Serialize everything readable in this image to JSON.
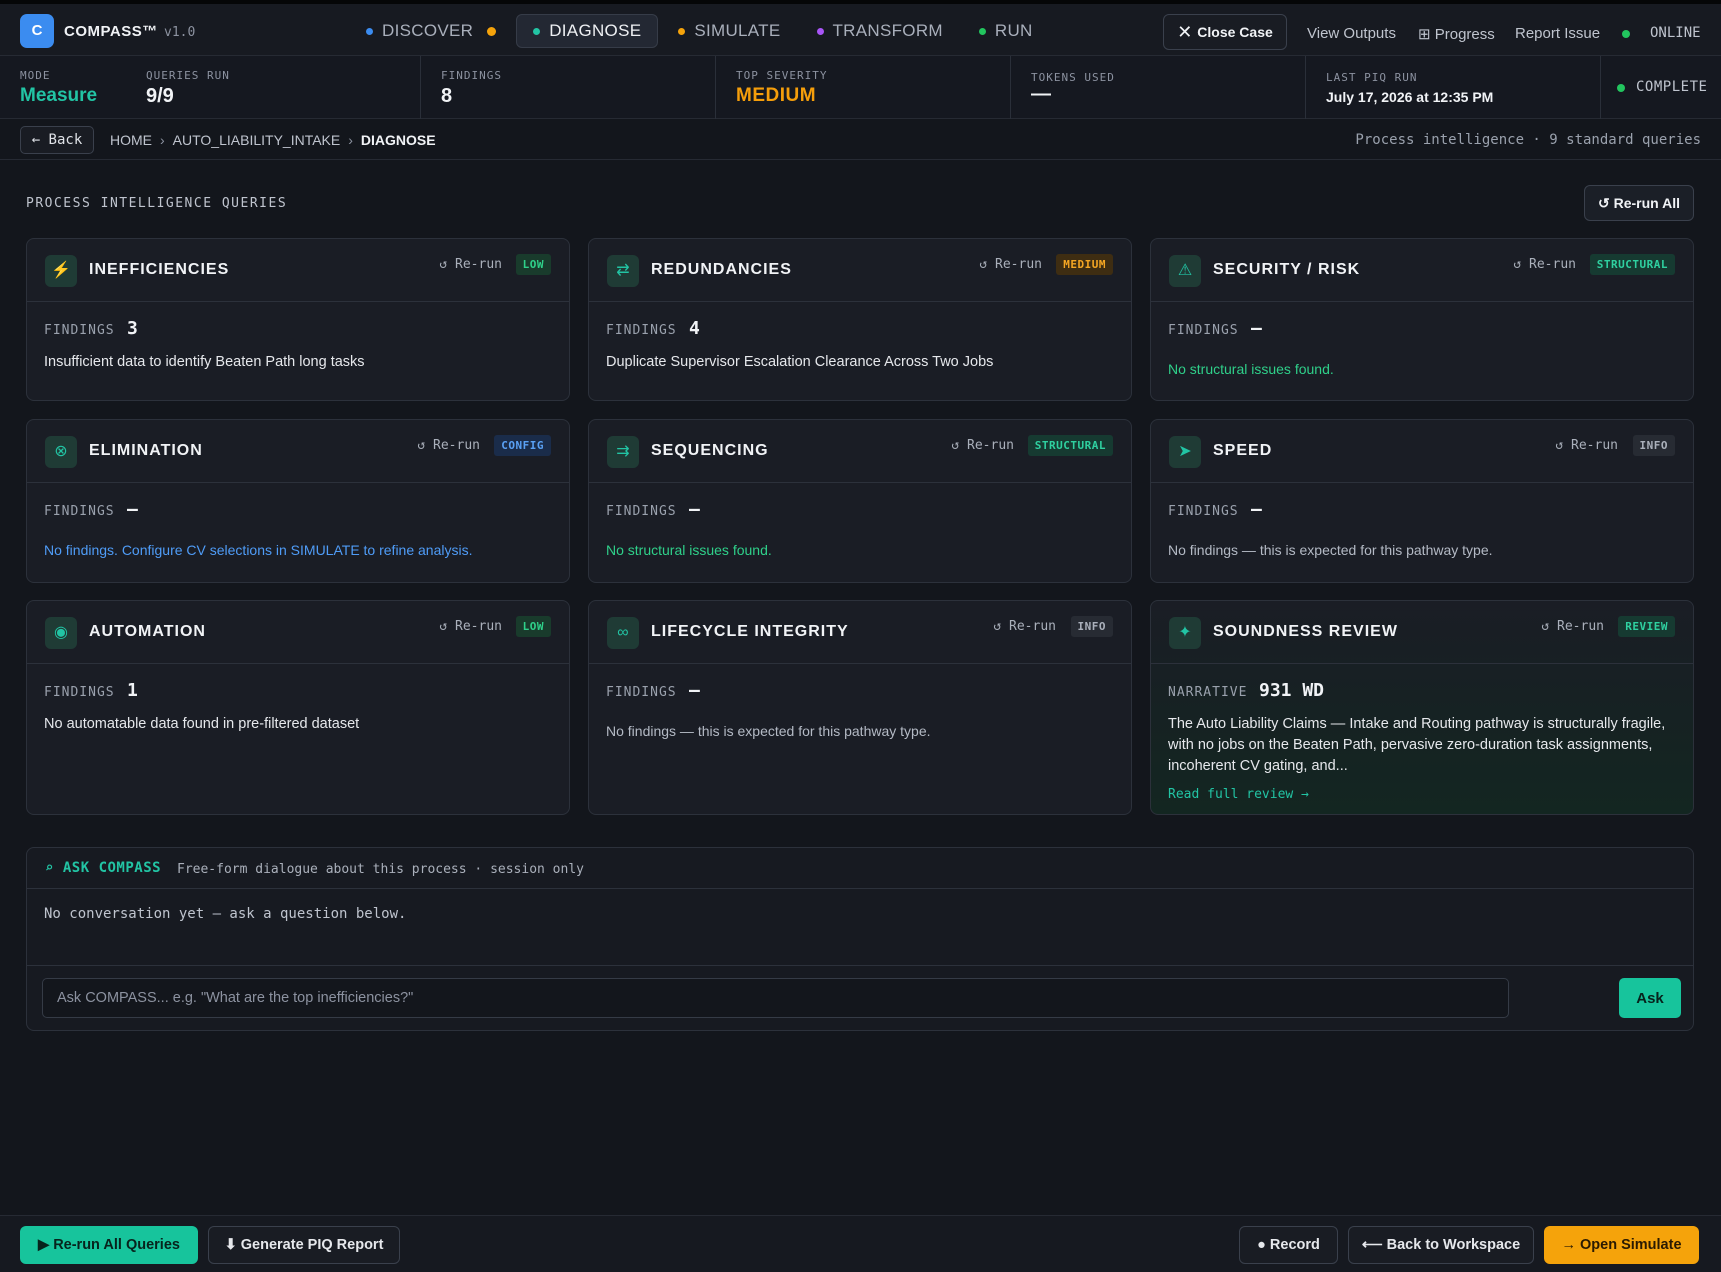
{
  "app": {
    "logo_letter": "C",
    "name": "COMPASS™",
    "version": "v1.0"
  },
  "nav": {
    "tabs": [
      {
        "label": "DISCOVER",
        "dot_color": "#3b8cf0",
        "tail_dot_color": "#f5a30b"
      },
      {
        "label": "DIAGNOSE",
        "dot_color": "#22c4a4",
        "active": true
      },
      {
        "label": "SIMULATE",
        "dot_color": "#f5a30b"
      },
      {
        "label": "TRANSFORM",
        "dot_color": "#a855f7"
      },
      {
        "label": "RUN",
        "dot_color": "#22c55e"
      }
    ],
    "close_case": "Close Case",
    "view_outputs": "View Outputs",
    "progress_icon": "⊞",
    "progress": "Progress",
    "report_issue": "Report Issue",
    "status": "ONLINE"
  },
  "stats": {
    "mode_label": "MODE",
    "mode_value": "Measure",
    "queries_label": "QUERIES RUN",
    "queries_value": "9/9",
    "findings_label": "FINDINGS",
    "findings_value": "8",
    "severity_label": "TOP SEVERITY",
    "severity_value": "MEDIUM",
    "tokens_label": "TOKENS USED",
    "tokens_value": "—",
    "last_run_label": "LAST PIQ RUN",
    "last_run_value": "July 17, 2026 at 12:35 PM",
    "status": "COMPLETE"
  },
  "breadcrumb": {
    "back": "← Back",
    "items": [
      "HOME",
      "AUTO_LIABILITY_INTAKE",
      "DIAGNOSE"
    ],
    "sep": "›",
    "right": "Process intelligence · 9 standard queries"
  },
  "section": {
    "title": "PROCESS INTELLIGENCE QUERIES",
    "rerun_all": "↺ Re-run All"
  },
  "rerun_label": "↺ Re-run",
  "cards": [
    {
      "icon": "⚡",
      "icon_name": "lightning-icon",
      "icon_color": "#f59e0b",
      "title": "INEFFICIENCIES",
      "badge": "LOW",
      "badge_type": "low",
      "findings_label": "FINDINGS",
      "findings": "3",
      "desc": "Insufficient data to identify Beaten Path long tasks",
      "desc_style": "normal"
    },
    {
      "icon": "⇄",
      "icon_name": "swap-arrows-icon",
      "icon_color": "#22c4a4",
      "title": "REDUNDANCIES",
      "badge": "MEDIUM",
      "badge_type": "medium",
      "findings_label": "FINDINGS",
      "findings": "4",
      "desc": "Duplicate Supervisor Escalation Clearance Across Two Jobs",
      "desc_style": "normal"
    },
    {
      "icon": "⚠",
      "icon_name": "warning-triangle-icon",
      "icon_color": "#22c4a4",
      "title": "SECURITY / RISK",
      "badge": "STRUCTURAL",
      "badge_type": "structural",
      "findings_label": "FINDINGS",
      "findings": "—",
      "desc": "No structural issues found.",
      "desc_style": "green"
    },
    {
      "icon": "⊗",
      "icon_name": "circle-x-icon",
      "icon_color": "#22c4a4",
      "title": "ELIMINATION",
      "badge": "CONFIG",
      "badge_type": "config",
      "findings_label": "FINDINGS",
      "findings": "—",
      "desc": "No findings. Configure CV selections in SIMULATE to refine analysis.",
      "desc_style": "blue"
    },
    {
      "icon": "⇉",
      "icon_name": "sequence-arrows-icon",
      "icon_color": "#22c4a4",
      "title": "SEQUENCING",
      "badge": "STRUCTURAL",
      "badge_type": "structural",
      "findings_label": "FINDINGS",
      "findings": "—",
      "desc": "No structural issues found.",
      "desc_style": "green"
    },
    {
      "icon": "➤",
      "icon_name": "send-arrow-icon",
      "icon_color": "#22c4a4",
      "title": "SPEED",
      "badge": "INFO",
      "badge_type": "info",
      "findings_label": "FINDINGS",
      "findings": "—",
      "desc": "No findings — this is expected for this pathway type.",
      "desc_style": "muted"
    },
    {
      "icon": "◉",
      "icon_name": "gear-icon",
      "icon_color": "#22c4a4",
      "title": "AUTOMATION",
      "badge": "LOW",
      "badge_type": "low",
      "findings_label": "FINDINGS",
      "findings": "1",
      "desc": "No automatable data found in pre-filtered dataset",
      "desc_style": "normal"
    },
    {
      "icon": "∞",
      "icon_name": "infinity-icon",
      "icon_color": "#22c4a4",
      "title": "LIFECYCLE INTEGRITY",
      "badge": "INFO",
      "badge_type": "info",
      "findings_label": "FINDINGS",
      "findings": "—",
      "desc": "No findings — this is expected for this pathway type.",
      "desc_style": "muted"
    },
    {
      "icon": "✦",
      "icon_name": "sparkle-icon",
      "icon_color": "#22c4a4",
      "title": "SOUNDNESS REVIEW",
      "badge": "REVIEW",
      "badge_type": "review",
      "findings_label": "NARRATIVE",
      "findings": "931 WD",
      "desc": "The Auto Liability Claims — Intake and Routing pathway is structurally fragile, with no jobs on the Beaten Path, pervasive zero-duration task assignments, incoherent CV gating, and...",
      "desc_style": "normal",
      "read_more": "Read full review →"
    }
  ],
  "ask": {
    "title": "⌕ ASK COMPASS",
    "subtitle": "Free-form dialogue about this process · session only",
    "empty": "No conversation yet — ask a question below.",
    "placeholder": "Ask COMPASS... e.g. \"What are the top inefficiencies?\"",
    "button": "Ask"
  },
  "footer": {
    "rerun_all": "▶ Re-run All Queries",
    "generate": "⬇ Generate PIQ Report",
    "record": "● Record",
    "back_workspace": "⟵ Back to Workspace",
    "open_simulate": "→ Open Simulate"
  }
}
